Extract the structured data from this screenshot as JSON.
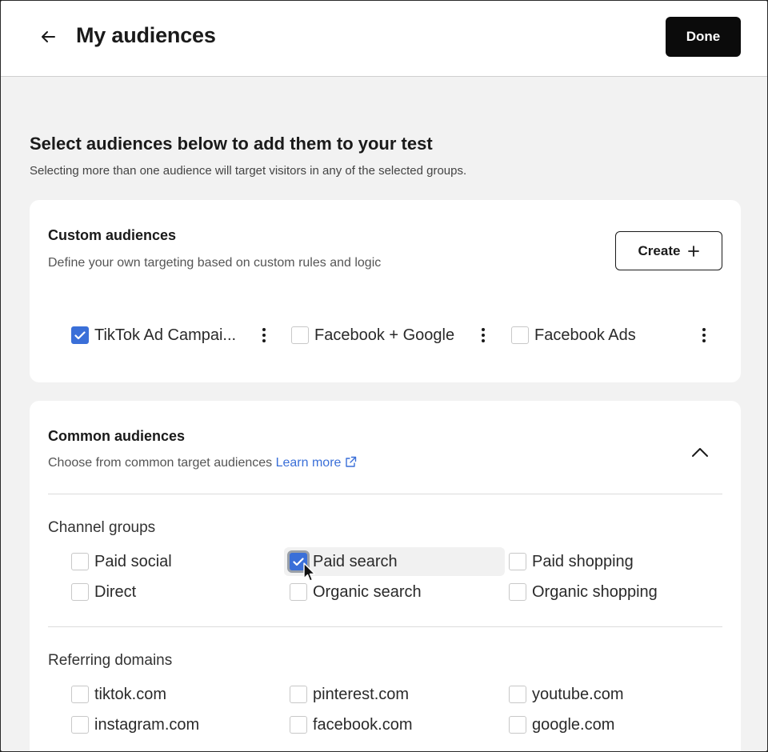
{
  "header": {
    "title": "My audiences",
    "done_label": "Done",
    "back_icon": "arrow-left-icon"
  },
  "intro": {
    "title": "Select audiences below to add them to your test",
    "subtitle": "Selecting more than one audience will target visitors in any of the selected groups."
  },
  "custom": {
    "title": "Custom audiences",
    "subtitle": "Define your own targeting based on custom rules and logic",
    "create_label": "Create",
    "items": [
      {
        "label": "TikTok Ad Campai...",
        "checked": true
      },
      {
        "label": "Facebook + Google",
        "checked": false
      },
      {
        "label": "Facebook Ads",
        "checked": false
      }
    ]
  },
  "common": {
    "title": "Common audiences",
    "subtitle": "Choose from common target audiences",
    "learn_more": "Learn more",
    "channel_groups": {
      "title": "Channel groups",
      "items": [
        {
          "label": "Paid social",
          "checked": false
        },
        {
          "label": "Paid search",
          "checked": true
        },
        {
          "label": "Paid shopping",
          "checked": false
        },
        {
          "label": "Direct",
          "checked": false
        },
        {
          "label": "Organic search",
          "checked": false
        },
        {
          "label": "Organic shopping",
          "checked": false
        }
      ]
    },
    "referring_domains": {
      "title": "Referring domains",
      "items": [
        {
          "label": "tiktok.com",
          "checked": false
        },
        {
          "label": "pinterest.com",
          "checked": false
        },
        {
          "label": "youtube.com",
          "checked": false
        },
        {
          "label": "instagram.com",
          "checked": false
        },
        {
          "label": "facebook.com",
          "checked": false
        },
        {
          "label": "google.com",
          "checked": false
        }
      ]
    }
  },
  "colors": {
    "accent": "#3a6fd8",
    "done_bg": "#0b0b0b",
    "page_bg": "#f2f2f2"
  }
}
